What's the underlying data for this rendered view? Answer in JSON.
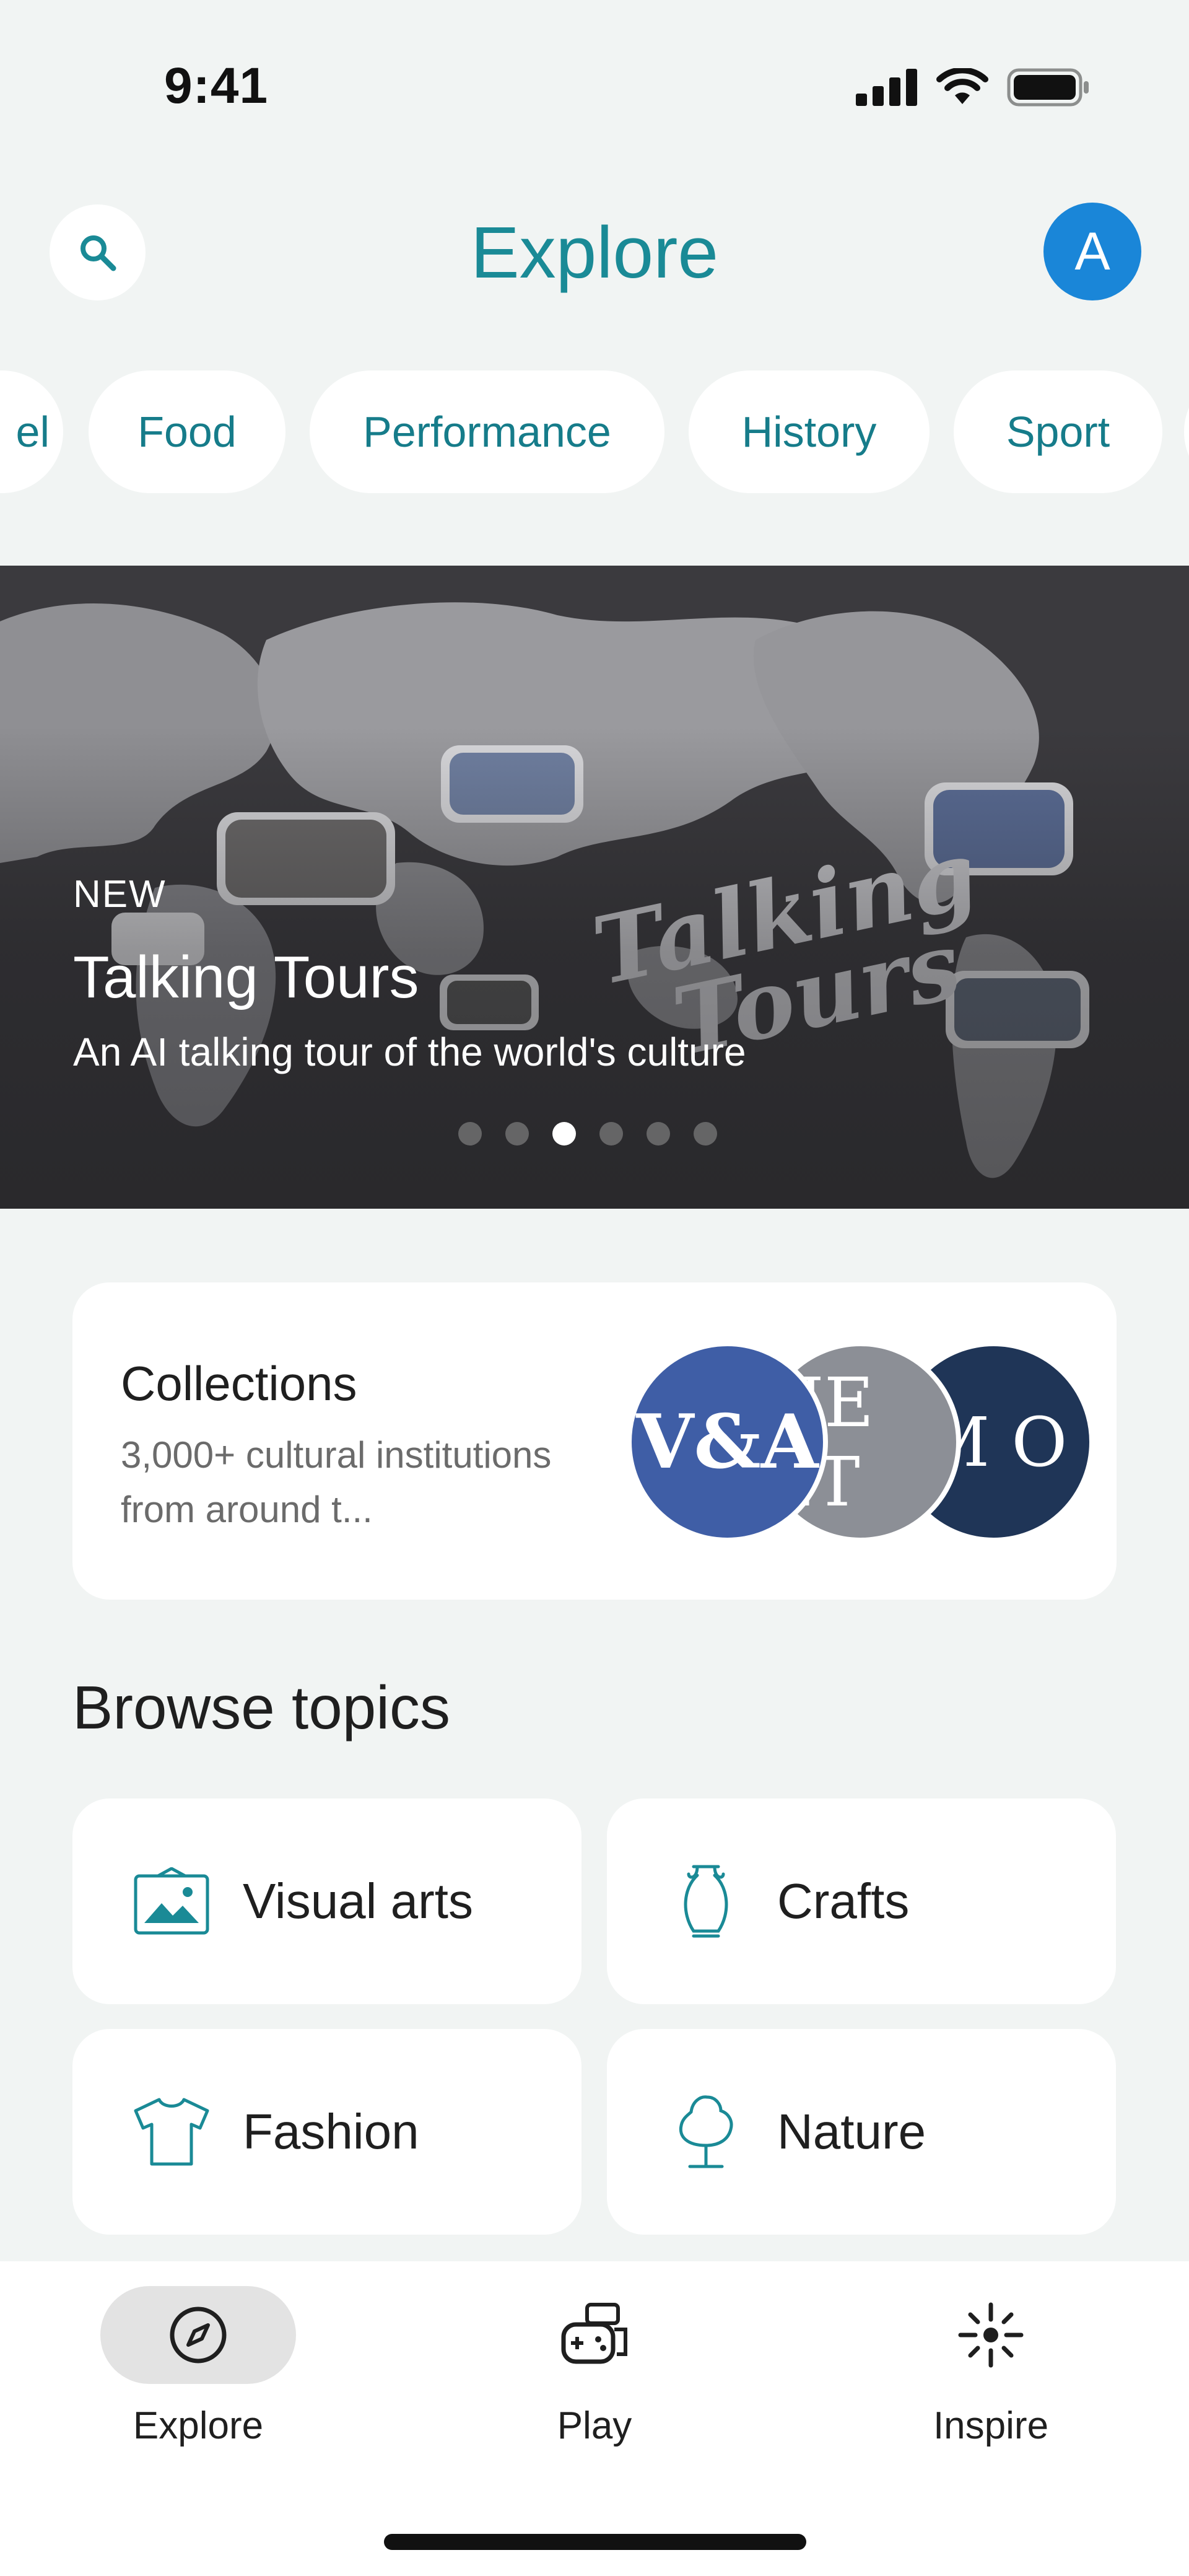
{
  "status_bar": {
    "time": "9:41",
    "icons": [
      "signal-icon",
      "wifi-icon",
      "battery-icon"
    ]
  },
  "header": {
    "title": "Explore",
    "avatar_initial": "A",
    "search_icon": "search-icon"
  },
  "chips": [
    "el",
    "Food",
    "Performance",
    "History",
    "Sport"
  ],
  "hero": {
    "label": "NEW",
    "title": "Talking Tours",
    "subtitle": "An AI talking tour of the world's culture",
    "artwork_text": [
      "Talking",
      "Tours"
    ],
    "page_count": 6,
    "active_page": 3
  },
  "collections": {
    "title": "Collections",
    "description": "3,000+ cultural institutions from around t...",
    "logos": [
      {
        "text": "V&A",
        "color": "#3f5ea6"
      },
      {
        "text": "HE ET",
        "color": "#8c8f96"
      },
      {
        "text": "M O",
        "color": "#1f3557"
      }
    ]
  },
  "browse": {
    "title": "Browse topics",
    "topics": [
      {
        "label": "Visual arts",
        "icon": "picture-frame-icon"
      },
      {
        "label": "Crafts",
        "icon": "vase-icon"
      },
      {
        "label": "Fashion",
        "icon": "tshirt-icon"
      },
      {
        "label": "Nature",
        "icon": "tree-icon"
      }
    ]
  },
  "bottom_nav": [
    {
      "label": "Explore",
      "icon": "compass-icon",
      "active": true
    },
    {
      "label": "Play",
      "icon": "game-controller-icon",
      "active": false
    },
    {
      "label": "Inspire",
      "icon": "sparkle-icon",
      "active": false
    }
  ],
  "colors": {
    "accent": "#1a8a96",
    "avatar": "#1a86d8",
    "background": "#f1f4f3"
  }
}
